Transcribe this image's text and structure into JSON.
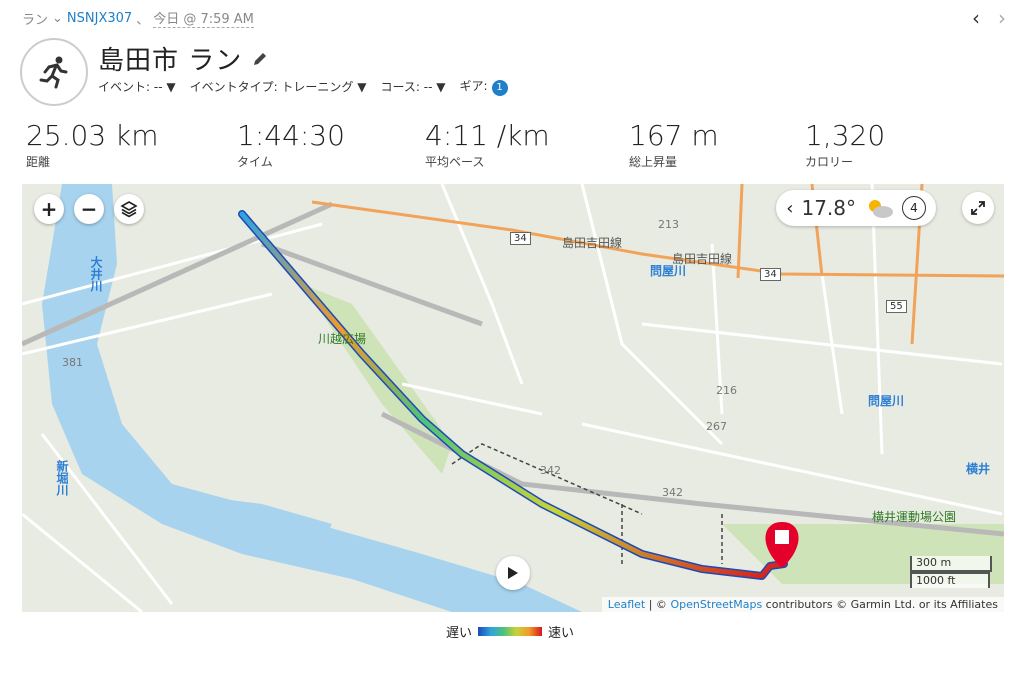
{
  "breadcrumb": {
    "activity": "ラン",
    "device": "NSNJX307",
    "separator": "、",
    "time": "今日 @ 7:59 AM"
  },
  "header": {
    "title": "島田市 ラン",
    "event": "イベント: --",
    "event_type": "イベントタイプ: トレーニング",
    "course": "コース: --",
    "gear": "ギア:",
    "gear_count": "1"
  },
  "stats": [
    {
      "value": "25.03 km",
      "label": "距離"
    },
    {
      "value": "1:44:30",
      "label": "タイム"
    },
    {
      "value": "4:11 /km",
      "label": "平均ペース"
    },
    {
      "value": "167 m",
      "label": "総上昇量"
    },
    {
      "value": "1,320",
      "label": "カロリー"
    }
  ],
  "map": {
    "zoom_in": "+",
    "zoom_out": "−",
    "weather_temp": "17.8°",
    "laps": "4",
    "scale_metric": "300 m",
    "scale_imperial": "1000 ft",
    "attribution_leaflet": "Leaflet",
    "attribution_sep": " | © ",
    "attribution_osm": "OpenStreetMaps",
    "attribution_rest": " contributors © Garmin Ltd. or its Affiliates",
    "labels": {
      "river_oi": "大井川",
      "river_toya1": "問屋川",
      "river_toya2": "問屋川",
      "river_shinsakai": "新堀川",
      "park_river": "川越広場",
      "park_sports": "横井運動場公園",
      "rail_shimada": "島田吉田線",
      "rail_shimada2": "島田吉田線",
      "yokoi": "横井",
      "route_34a": "34",
      "route_34b": "34",
      "route_55": "55",
      "r342a": "342",
      "r342b": "342",
      "r381": "381",
      "r213": "213",
      "r216": "216",
      "r267": "267"
    }
  },
  "legend": {
    "slow": "遅い",
    "fast": "速い"
  },
  "colors": {
    "accent": "#1f7fc9",
    "route_slow": "#1d4ab5",
    "route_fast": "#d7191c",
    "river": "#a7d3ee",
    "road_orange": "#f2a35a",
    "marker": "#e4002b"
  }
}
